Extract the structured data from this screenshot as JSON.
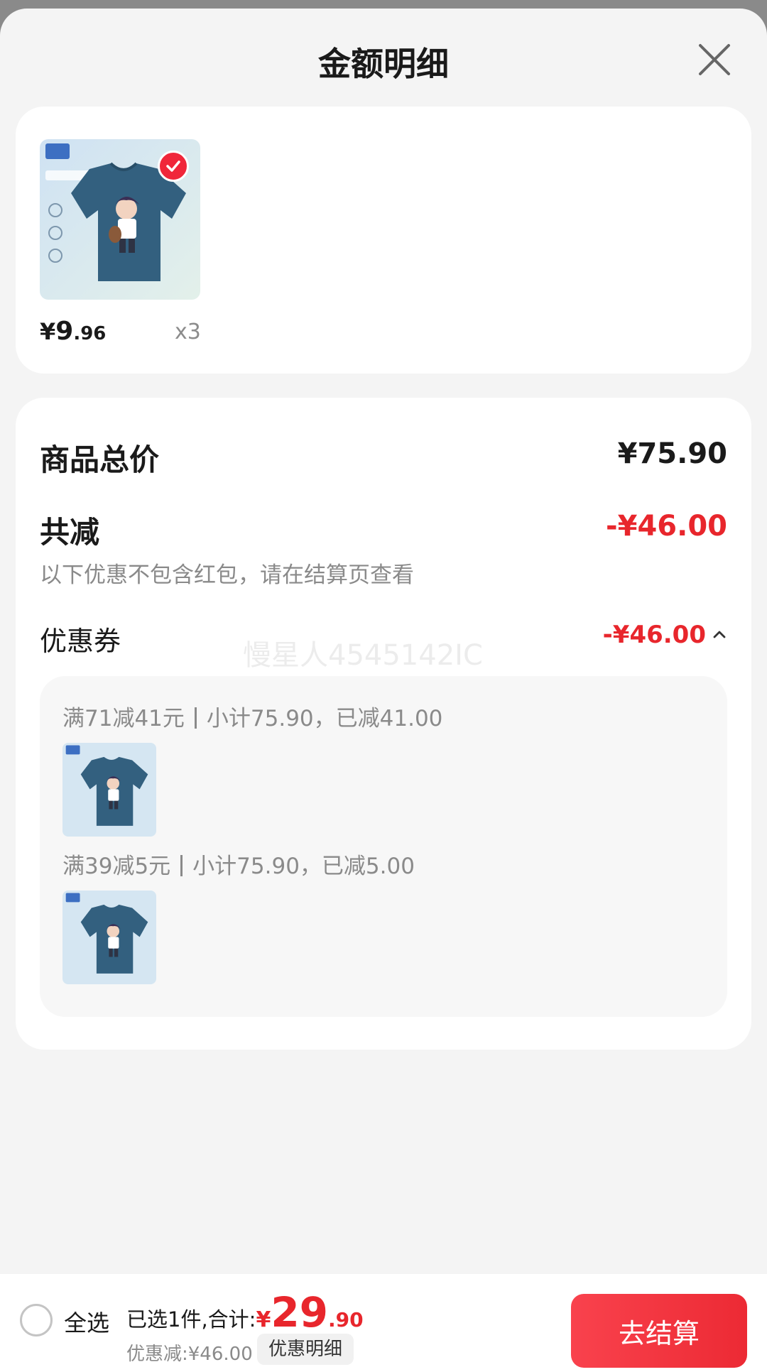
{
  "header": {
    "title": "金额明细",
    "close_icon": "close-icon"
  },
  "item": {
    "price_currency": "¥",
    "price_int": "9",
    "price_dec": ".96",
    "quantity": "x3",
    "selected": true
  },
  "summary": {
    "total_label": "商品总价",
    "total_value": "¥75.90",
    "reduce_label": "共减",
    "reduce_value": "-¥46.00",
    "note": "以下优惠不包含红包，请在结算页查看",
    "coupon_label": "优惠券",
    "coupon_value": "-¥46.00",
    "watermark": "慢星人4545142IC",
    "coupons": [
      {
        "condition": "满71减41元",
        "detail": "小计75.90，已减41.00"
      },
      {
        "condition": "满39减5元",
        "detail": "小计75.90，已减5.00"
      }
    ]
  },
  "bottom_bar": {
    "select_all": "全选",
    "selected_text": "已选1件,合计:",
    "total_currency": "¥",
    "total_int": "29",
    "total_dec": ".90",
    "saved_text": "优惠减:¥46.00",
    "detail_button": "优惠明细",
    "checkout_button": "去结算"
  },
  "colors": {
    "accent_red": "#e8262c",
    "shirt_blue": "#33607f",
    "page_bg": "#f4f4f4"
  }
}
